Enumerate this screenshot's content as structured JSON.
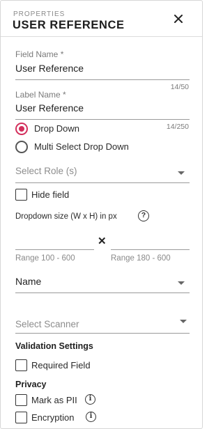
{
  "header": {
    "kicker": "PROPERTIES",
    "title": "USER REFERENCE",
    "close_icon": "close-icon"
  },
  "field_name": {
    "label": "Field Name *",
    "value": "User Reference",
    "counter": "14/50"
  },
  "label_name": {
    "label": "Label Name *",
    "value": "User Reference",
    "counter": "14/250"
  },
  "display_type": {
    "options": [
      {
        "label": "Drop Down",
        "selected": true
      },
      {
        "label": "Multi Select Drop Down",
        "selected": false
      }
    ],
    "accent_color": "#d32f5c"
  },
  "role_select": {
    "placeholder": "Select Role (s)"
  },
  "hide_field": {
    "label": "Hide field",
    "checked": false
  },
  "dropdown_size": {
    "label": "Dropdown size (W x H) in px",
    "separator": "✕",
    "width_range": "Range 100 - 600",
    "height_range": "Range 180 - 600",
    "help_icon": "help-circle-icon"
  },
  "name_select": {
    "value": "Name"
  },
  "scanner_select": {
    "placeholder": "Select Scanner"
  },
  "validation": {
    "heading": "Validation Settings",
    "required_label": "Required Field"
  },
  "privacy": {
    "heading": "Privacy",
    "pii_label": "Mark as PII",
    "encryption_label": "Encryption",
    "info_icon": "info-icon",
    "info_glyph": "i"
  }
}
